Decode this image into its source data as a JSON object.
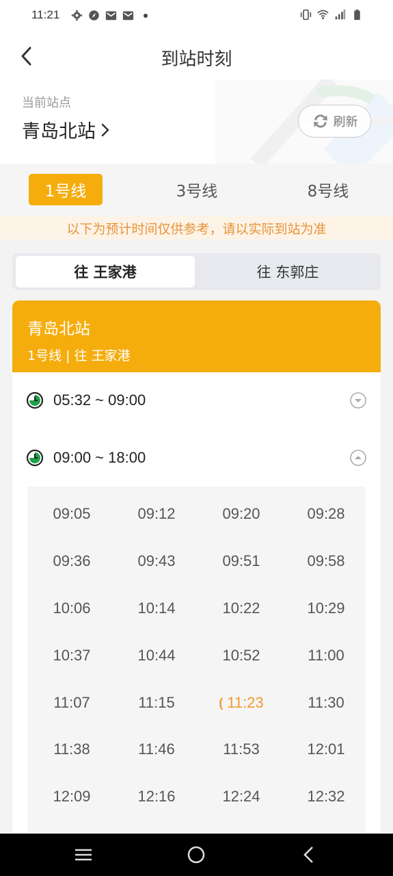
{
  "status_bar": {
    "time": "11:21"
  },
  "header": {
    "title": "到站时刻"
  },
  "station": {
    "label": "当前站点",
    "name": "青岛北站",
    "refresh_label": "刷新"
  },
  "line_tabs": [
    {
      "label": "1号线",
      "active": true
    },
    {
      "label": "3号线",
      "active": false
    },
    {
      "label": "8号线",
      "active": false
    }
  ],
  "notice": "以下为预计时间仅供参考，请以实际到站为准",
  "directions": [
    {
      "label": "往 王家港",
      "active": true
    },
    {
      "label": "往 东郭庄",
      "active": false
    }
  ],
  "card": {
    "station": "青岛北站",
    "subtitle": "1号线 | 往 王家港"
  },
  "periods": [
    {
      "range": "05:32 ~ 09:00",
      "expanded": false
    },
    {
      "range": "09:00 ~ 18:00",
      "expanded": true
    }
  ],
  "times": [
    [
      "09:05",
      "09:12",
      "09:20",
      "09:28"
    ],
    [
      "09:36",
      "09:43",
      "09:51",
      "09:58"
    ],
    [
      "10:06",
      "10:14",
      "10:22",
      "10:29"
    ],
    [
      "10:37",
      "10:44",
      "10:52",
      "11:00"
    ],
    [
      "11:07",
      "11:15",
      "11:23",
      "11:30"
    ],
    [
      "11:38",
      "11:46",
      "11:53",
      "12:01"
    ],
    [
      "12:09",
      "12:16",
      "12:24",
      "12:32"
    ]
  ],
  "current_time": "11:23",
  "colors": {
    "accent": "#f5ad0e",
    "notice_text": "#e8933a",
    "current": "#f29a2e"
  }
}
